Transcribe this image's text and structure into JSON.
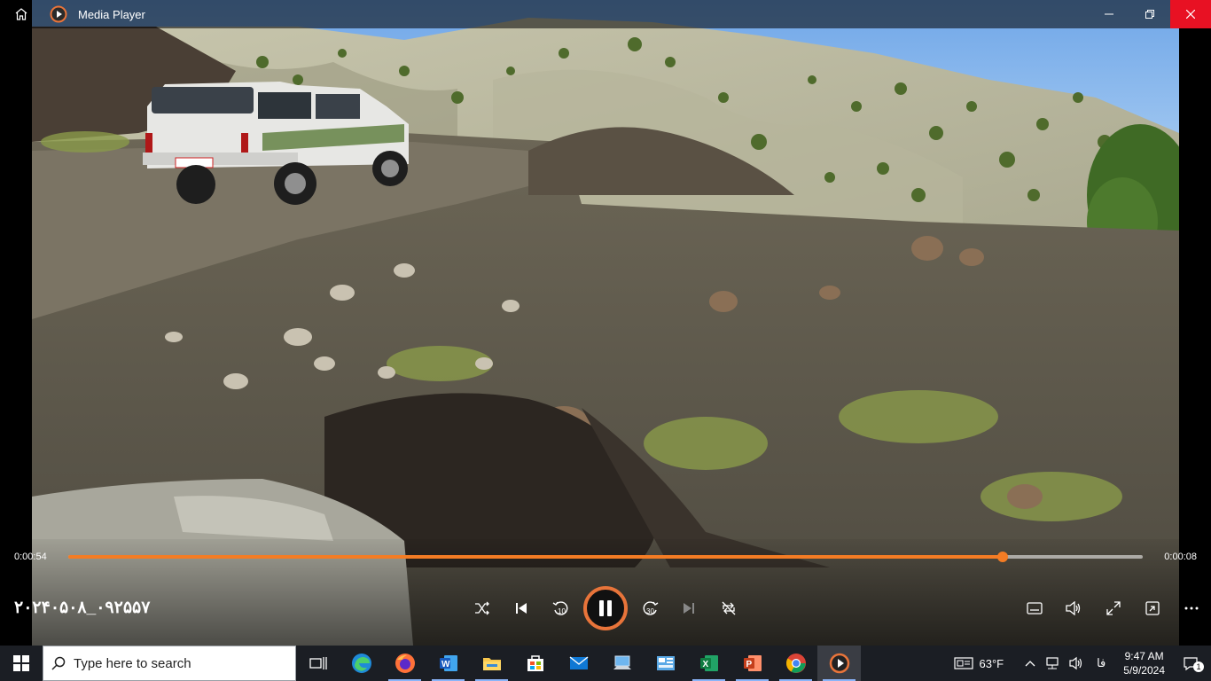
{
  "window": {
    "title": "Media Player",
    "icons": {
      "home": "home-icon",
      "app": "media-player-icon",
      "minimize": "minimize-icon",
      "restore": "restore-icon",
      "close": "close-icon"
    }
  },
  "playback": {
    "elapsed": "0:00:54",
    "remaining": "0:00:08",
    "progress_fraction": 0.87,
    "file_title": "۲۰۲۴۰۵۰۸_۰۹۲۵۵۷",
    "accent_color": "#f47c24",
    "skip_back_label": "10",
    "skip_forward_label": "30",
    "state": "playing"
  },
  "taskbar": {
    "search_placeholder": "Type here to search",
    "apps": [
      "task-view",
      "edge",
      "firefox",
      "word",
      "file-explorer",
      "microsoft-store",
      "mail",
      "network-computer",
      "control-panel",
      "excel",
      "powerpoint",
      "chrome",
      "media-player"
    ],
    "weather": "63°F",
    "language": "فا",
    "time": "9:47 AM",
    "date": "5/9/2024",
    "notification_count": "1"
  }
}
